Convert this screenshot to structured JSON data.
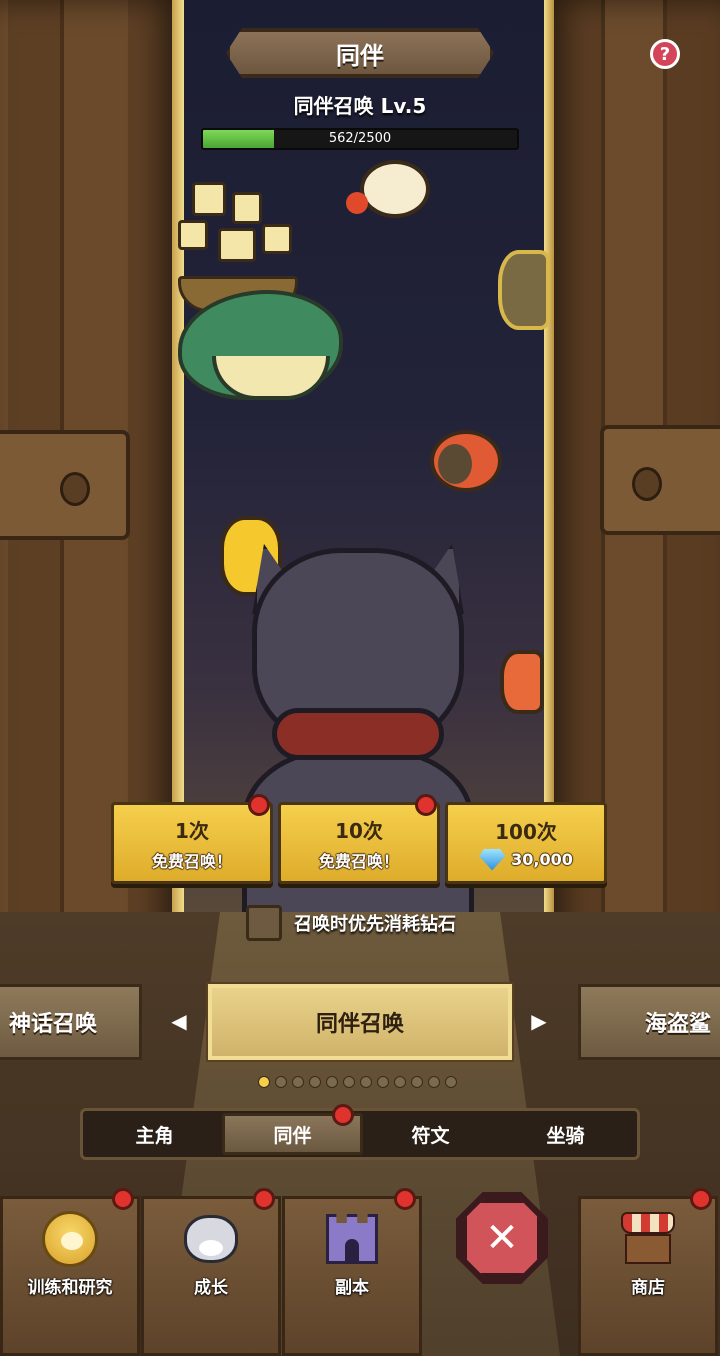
{
  "header": {
    "title": "同伴",
    "help_icon": "?",
    "summon_level_text": "同伴召唤 Lv.5",
    "xp_text": "562/2500",
    "xp_current": 562,
    "xp_max": 2500
  },
  "summon_buttons": [
    {
      "count": "1次",
      "label": "免费召唤！",
      "has_badge": true
    },
    {
      "count": "10次",
      "label": "免费召唤！",
      "has_badge": true
    },
    {
      "count": "100次",
      "cost": "30,000",
      "has_badge": false
    }
  ],
  "prefer_gems": {
    "label": "召唤时优先消耗钻石",
    "checked": false
  },
  "carousel": {
    "left_label": "神话召唤",
    "center_label": "同伴召唤",
    "right_label": "海盗鲨",
    "page_count": 12,
    "active_page": 1
  },
  "category_tabs": [
    {
      "label": "主角",
      "active": false
    },
    {
      "label": "同伴",
      "active": true
    },
    {
      "label": "符文",
      "active": false
    },
    {
      "label": "坐骑",
      "active": false
    }
  ],
  "bottom_nav": [
    {
      "label": "训练和研究",
      "icon": "paw-icon"
    },
    {
      "label": "成长",
      "icon": "cat-face-icon"
    },
    {
      "label": "副本",
      "icon": "castle-icon"
    },
    {
      "label": "商店",
      "icon": "shop-icon"
    }
  ],
  "close_icon": "✕",
  "colors": {
    "accent_gold": "#f5cf4d",
    "badge_red": "#e0332e",
    "xp_green": "#7ed957",
    "close_red": "#d0545a"
  }
}
